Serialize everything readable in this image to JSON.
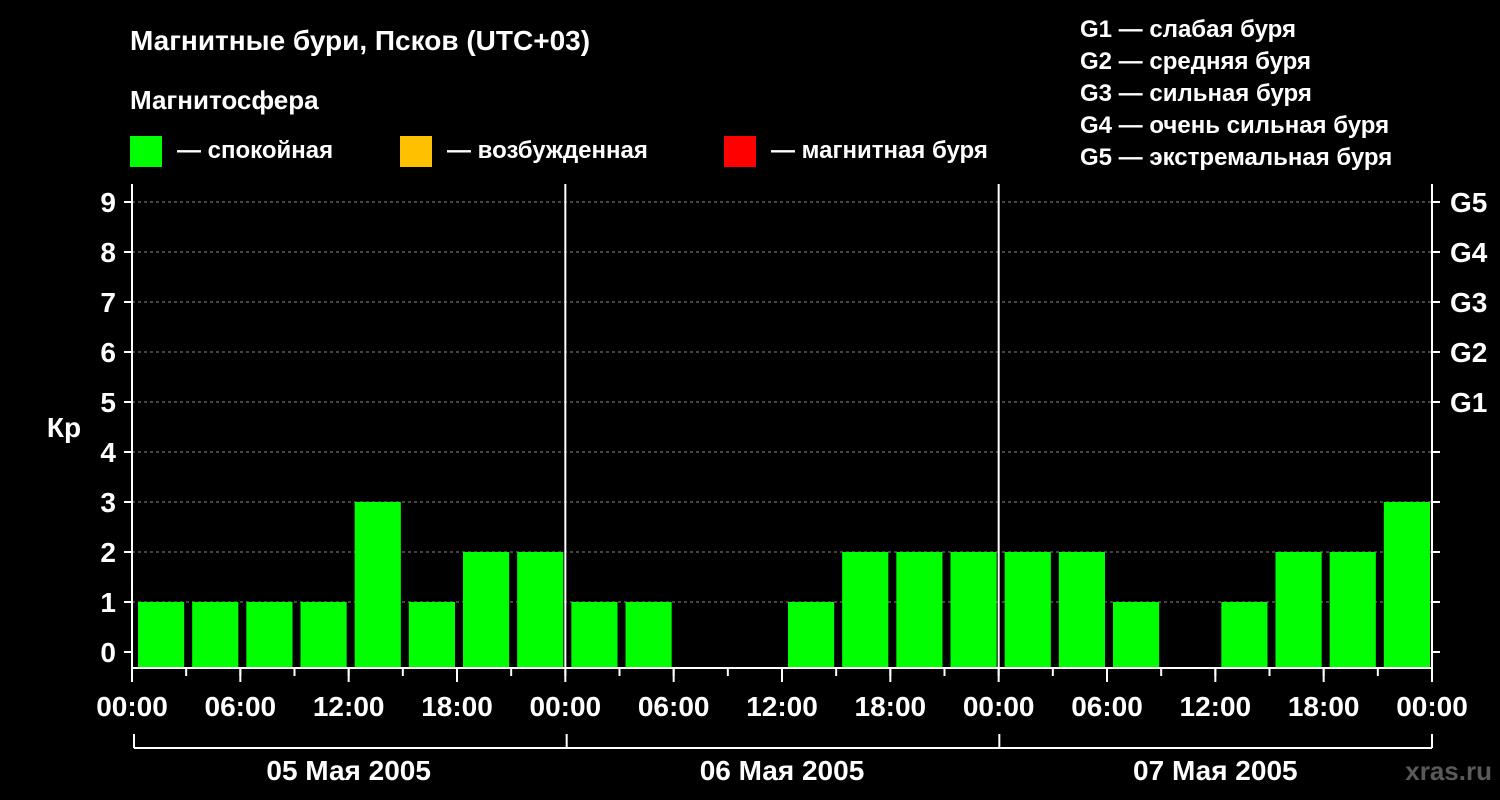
{
  "chart_data": {
    "type": "bar",
    "title": "Магнитные бури, Псков (UTC+03)",
    "subtitle": "Магнитосфера",
    "ylabel": "Кр",
    "ylim": [
      0,
      9
    ],
    "y_ticks": [
      "0",
      "1",
      "2",
      "3",
      "4",
      "5",
      "6",
      "7",
      "8",
      "9"
    ],
    "right_ticks": [
      {
        "y": 5,
        "label": "G1"
      },
      {
        "y": 6,
        "label": "G2"
      },
      {
        "y": 7,
        "label": "G3"
      },
      {
        "y": 8,
        "label": "G4"
      },
      {
        "y": 9,
        "label": "G5"
      }
    ],
    "x_tick_labels": [
      "00:00",
      "06:00",
      "12:00",
      "18:00",
      "00:00",
      "06:00",
      "12:00",
      "18:00",
      "00:00",
      "06:00",
      "12:00",
      "18:00",
      "00:00"
    ],
    "day_labels": [
      "05 Мая 2005",
      "06 Мая 2005",
      "07 Мая 2005"
    ],
    "values": [
      1,
      1,
      1,
      1,
      3,
      1,
      2,
      2,
      1,
      1,
      0,
      0,
      1,
      2,
      2,
      2,
      2,
      2,
      1,
      0,
      1,
      2,
      2,
      3
    ],
    "grid": true,
    "legend": [
      {
        "label": "— спокойная",
        "color": "#00ff00"
      },
      {
        "label": "— возбужденная",
        "color": "#ffc000"
      },
      {
        "label": "— магнитная буря",
        "color": "#ff0000"
      }
    ],
    "g_scale": [
      "G1 — слабая буря",
      "G2 — средняя буря",
      "G3 — сильная буря",
      "G4 — очень сильная буря",
      "G5 — экстремальная буря"
    ],
    "bar_color": "#00ff00",
    "watermark": "xras.ru"
  }
}
